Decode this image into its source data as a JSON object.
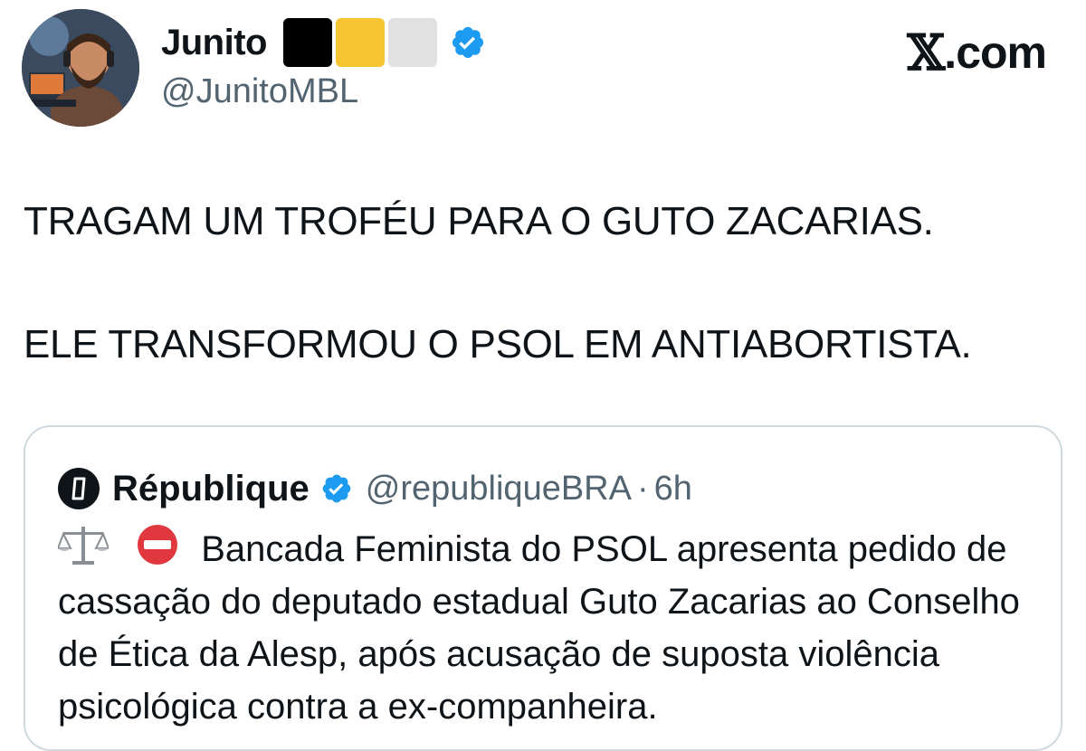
{
  "author": {
    "display_name": "Junito",
    "handle": "@JunitoMBL",
    "flag_colors": [
      "#000000",
      "#f6c531",
      "#d9d9d9"
    ],
    "verified": true
  },
  "brand": {
    "logo_text": "𝕏",
    "suffix": ".com"
  },
  "tweet": {
    "paragraphs": [
      "TRAGAM UM TROFÉU PARA O GUTO ZACARIAS.",
      "ELE TRANSFORMOU O PSOL EM ANTIABORTISTA."
    ]
  },
  "quote": {
    "name": "République",
    "handle": "@republiqueBRA",
    "separator": "·",
    "time": "6h",
    "verified": true,
    "body": "Bancada Feminista do PSOL apresenta pedido de cassação do deputado estadual Guto Zacarias ao Conselho de Ética da Alesp, após acusação de suposta violência psicológica contra a ex-companheira."
  },
  "colors": {
    "verified_blue": "#1d9bf0",
    "secondary_text": "#536471",
    "border": "#cfd9de",
    "no_entry_red": "#e0383e"
  },
  "icons": [
    "verified-badge-icon",
    "balance-scale-icon",
    "no-entry-icon",
    "republique-logo-icon"
  ]
}
